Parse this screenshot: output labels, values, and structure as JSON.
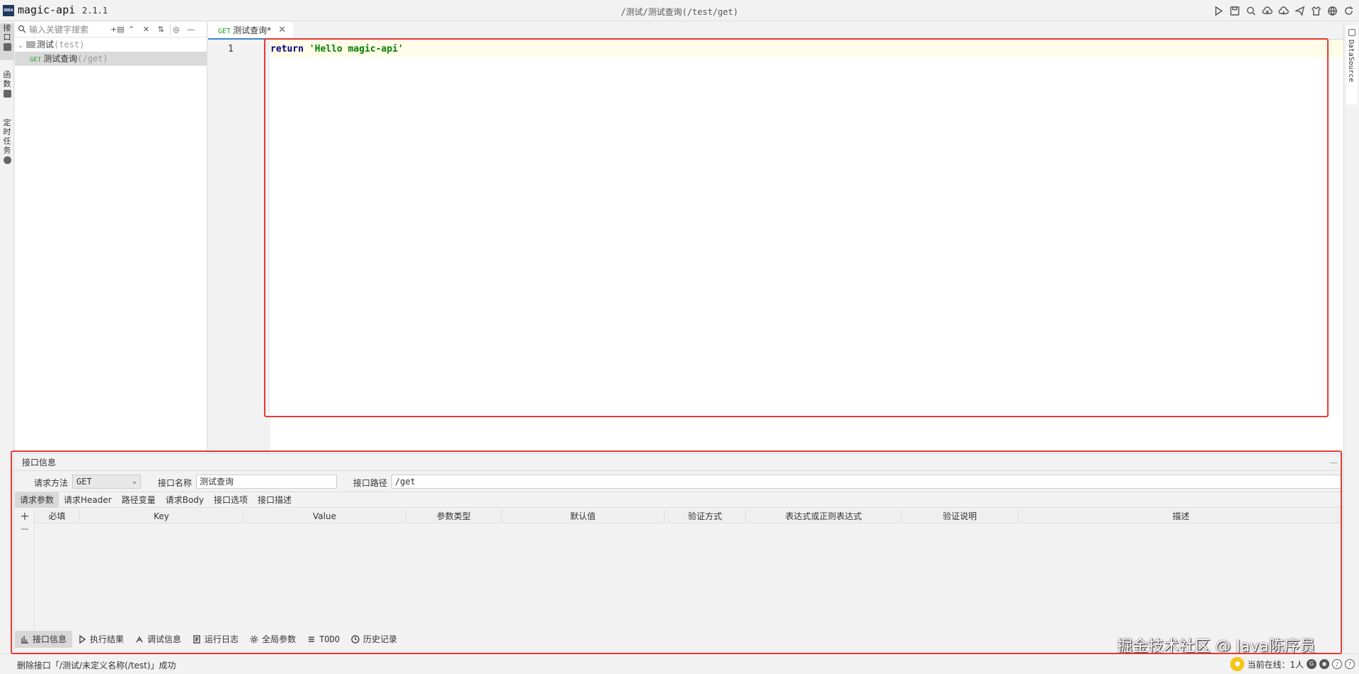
{
  "app": {
    "name": "magic-api",
    "version": "2.1.1",
    "title_path": "/测试/测试查询(/test/get)",
    "logo_text": "IDEA"
  },
  "left_tabs": [
    "接口",
    "函数",
    "定时任务"
  ],
  "tree": {
    "search_placeholder": "输入关键字搜索",
    "folder": {
      "name": "测试",
      "path": "(test)"
    },
    "item": {
      "method": "GET",
      "name": "测试查询",
      "path": "(/get)"
    }
  },
  "editor": {
    "tab": {
      "method": "GET",
      "name": "测试查询*"
    },
    "line_number": "1",
    "code": {
      "keyword": "return",
      "string": "'Hello magic-api'"
    }
  },
  "right_tab": "DataSource",
  "panel": {
    "title": "接口信息",
    "minimize": "—",
    "method_label": "请求方法",
    "method_value": "GET",
    "name_label": "接口名称",
    "name_value": "测试查询",
    "path_label": "接口路径",
    "path_value": "/get",
    "sub_tabs": [
      "请求参数",
      "请求Header",
      "路径变量",
      "请求Body",
      "接口选项",
      "接口描述"
    ],
    "columns": [
      "必填",
      "Key",
      "Value",
      "参数类型",
      "默认值",
      "验证方式",
      "表达式或正则表达式",
      "验证说明",
      "描述"
    ],
    "add_btn": "+",
    "remove_btn": "—"
  },
  "bottom_tabs": [
    "接口信息",
    "执行结果",
    "调试信息",
    "运行日志",
    "全局参数",
    "TODO",
    "历史记录"
  ],
  "status": {
    "message": "删除接口「/测试/未定义名称(/test)」成功",
    "online_label": "当前在线：1人"
  },
  "watermark": "掘金技术社区 @ Java陈序员",
  "colors": {
    "accent": "#4083c9",
    "annotation": "#e53935",
    "get_method": "#2ea02e"
  }
}
